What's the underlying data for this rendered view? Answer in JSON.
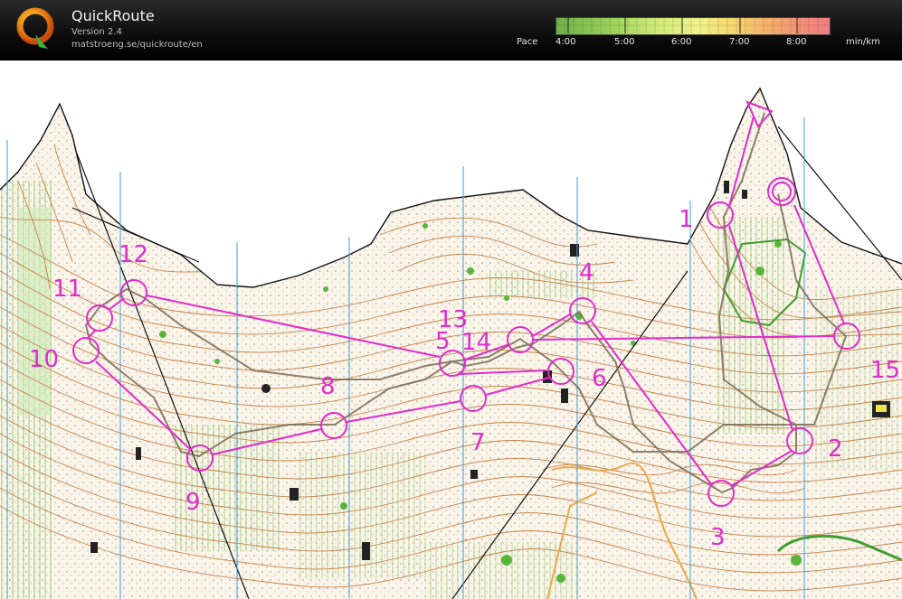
{
  "app": {
    "title": "QuickRoute",
    "version": "Version 2.4",
    "url": "matstroeng.se/quickroute/en",
    "logo_letter": "Q"
  },
  "pace": {
    "label": "Pace",
    "ticks": [
      "4:00",
      "5:00",
      "6:00",
      "7:00",
      "8:00"
    ],
    "unit": "min/km",
    "colors": [
      "#6fb04a",
      "#9bd15c",
      "#d3ec78",
      "#eef28a",
      "#f6d86e",
      "#f3a96a",
      "#ef7b82"
    ]
  },
  "map": {
    "course_color": "#e02ccd",
    "route_color": "#7a6a55",
    "controls": [
      "1",
      "2",
      "3",
      "4",
      "5",
      "6",
      "7",
      "8",
      "9",
      "10",
      "11",
      "12",
      "13",
      "14",
      "15"
    ],
    "map_colors": {
      "contour": "#b5733a",
      "vegetation": "#5fb83a",
      "water_meridian": "#3da0d6",
      "rock": "#000000"
    }
  }
}
